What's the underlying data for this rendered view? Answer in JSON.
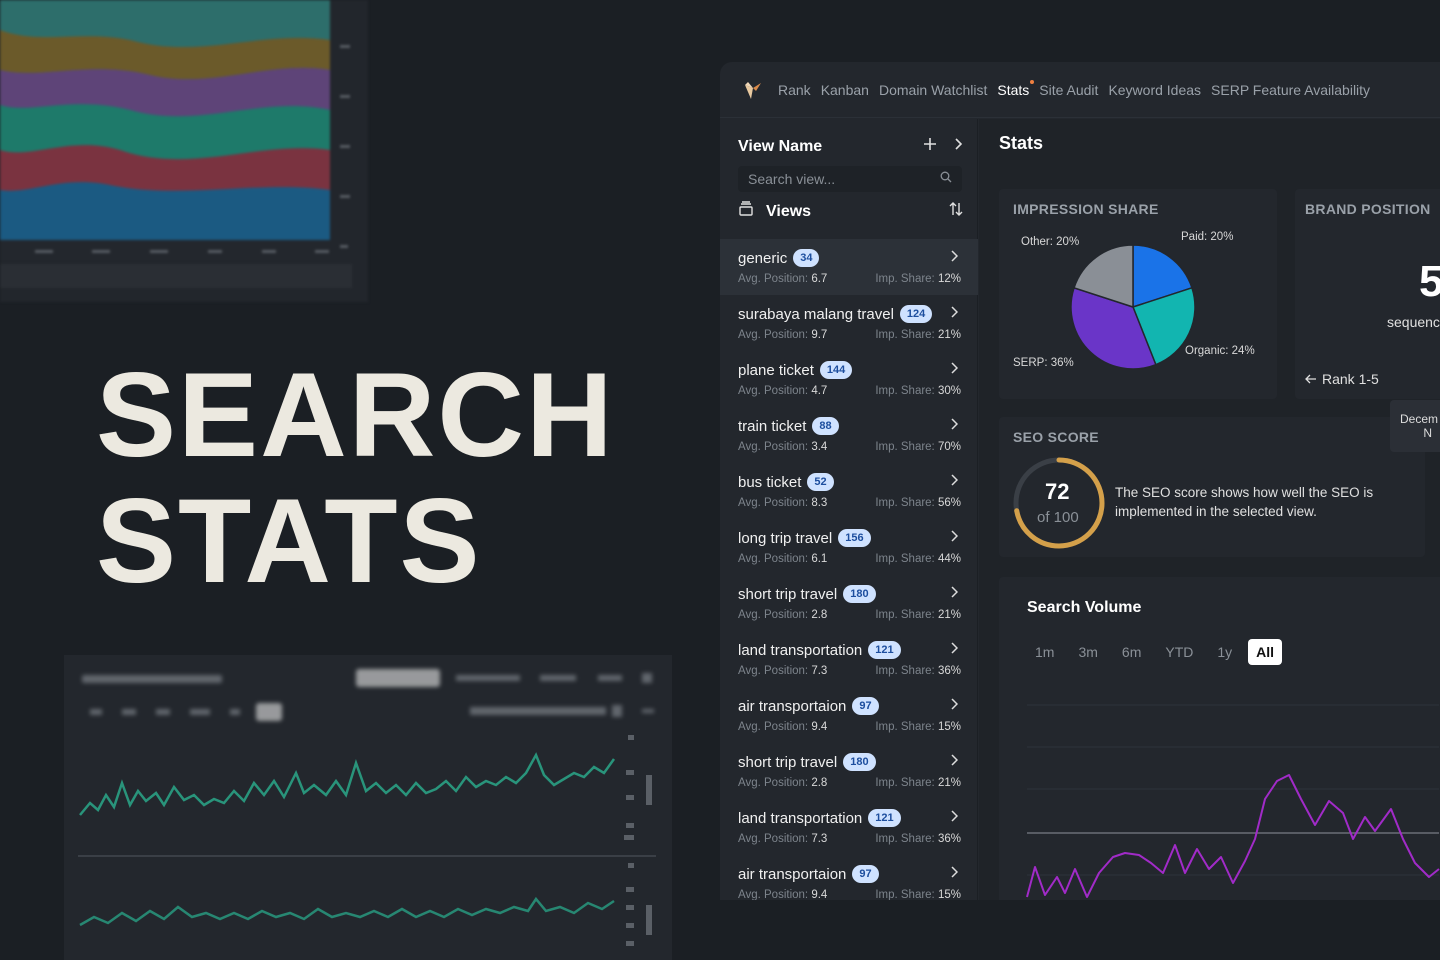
{
  "hero": {
    "line1": "SEARCH",
    "line2": "STATS"
  },
  "nav": {
    "items": [
      "Rank",
      "Kanban",
      "Domain Watchlist",
      "Stats",
      "Site Audit",
      "Keyword Ideas",
      "SERP Feature Availability"
    ],
    "active_index": 3
  },
  "sidebar": {
    "title": "View Name",
    "add_icon": "plus-icon",
    "search_placeholder": "Search view...",
    "views_label": "Views",
    "items": [
      {
        "name": "generic",
        "count": "34",
        "avg_label": "Avg. Position:",
        "avg": "6.7",
        "imp_label": "Imp. Share:",
        "imp": "12%"
      },
      {
        "name": "surabaya malang travel",
        "count": "124",
        "avg_label": "Avg. Position:",
        "avg": "9.7",
        "imp_label": "Imp. Share:",
        "imp": "21%"
      },
      {
        "name": "plane ticket",
        "count": "144",
        "avg_label": "Avg. Position:",
        "avg": "4.7",
        "imp_label": "Imp. Share:",
        "imp": "30%"
      },
      {
        "name": "train ticket",
        "count": "88",
        "avg_label": "Avg. Position:",
        "avg": "3.4",
        "imp_label": "Imp. Share:",
        "imp": "70%"
      },
      {
        "name": "bus ticket",
        "count": "52",
        "avg_label": "Avg. Position:",
        "avg": "8.3",
        "imp_label": "Imp. Share:",
        "imp": "56%"
      },
      {
        "name": "long trip travel",
        "count": "156",
        "avg_label": "Avg. Position:",
        "avg": "6.1",
        "imp_label": "Imp. Share:",
        "imp": "44%"
      },
      {
        "name": "short trip travel",
        "count": "180",
        "avg_label": "Avg. Position:",
        "avg": "2.8",
        "imp_label": "Imp. Share:",
        "imp": "21%"
      },
      {
        "name": "land transportation",
        "count": "121",
        "avg_label": "Avg. Position:",
        "avg": "7.3",
        "imp_label": "Imp. Share:",
        "imp": "36%"
      },
      {
        "name": "air transportaion",
        "count": "97",
        "avg_label": "Avg. Position:",
        "avg": "9.4",
        "imp_label": "Imp. Share:",
        "imp": "15%"
      },
      {
        "name": "short trip travel",
        "count": "180",
        "avg_label": "Avg. Position:",
        "avg": "2.8",
        "imp_label": "Imp. Share:",
        "imp": "21%"
      },
      {
        "name": "land transportation",
        "count": "121",
        "avg_label": "Avg. Position:",
        "avg": "7.3",
        "imp_label": "Imp. Share:",
        "imp": "36%"
      },
      {
        "name": "air transportaion",
        "count": "97",
        "avg_label": "Avg. Position:",
        "avg": "9.4",
        "imp_label": "Imp. Share:",
        "imp": "15%"
      }
    ]
  },
  "main": {
    "title": "Stats",
    "impression_share": {
      "title": "IMPRESSION SHARE",
      "slices": [
        {
          "label": "Paid: 20%",
          "value": 20,
          "color": "#1a73e8"
        },
        {
          "label": "Organic: 24%",
          "value": 24,
          "color": "#12b5b0"
        },
        {
          "label": "SERP: 36%",
          "value": 36,
          "color": "#6a35c8"
        },
        {
          "label": "Other: 20%",
          "value": 20,
          "color": "#8a8f96"
        }
      ]
    },
    "brand_position": {
      "title": "BRAND POSITION",
      "value": "5",
      "sub": "sequenc",
      "rank_link": "Rank 1-5"
    },
    "tooltip": {
      "line1": "Decem",
      "line2": "N"
    },
    "seo_score": {
      "title": "SEO SCORE",
      "score": "72",
      "of": "of 100",
      "value": 72,
      "description": "The SEO score shows how well the SEO is implemented in the selected view."
    },
    "search_volume": {
      "title": "Search Volume",
      "ranges": [
        "1m",
        "3m",
        "6m",
        "YTD",
        "1y",
        "All"
      ],
      "active_range": 5
    }
  },
  "colors": {
    "accent_ring": "#d4a04a",
    "volume_line": "#a12bc8"
  }
}
